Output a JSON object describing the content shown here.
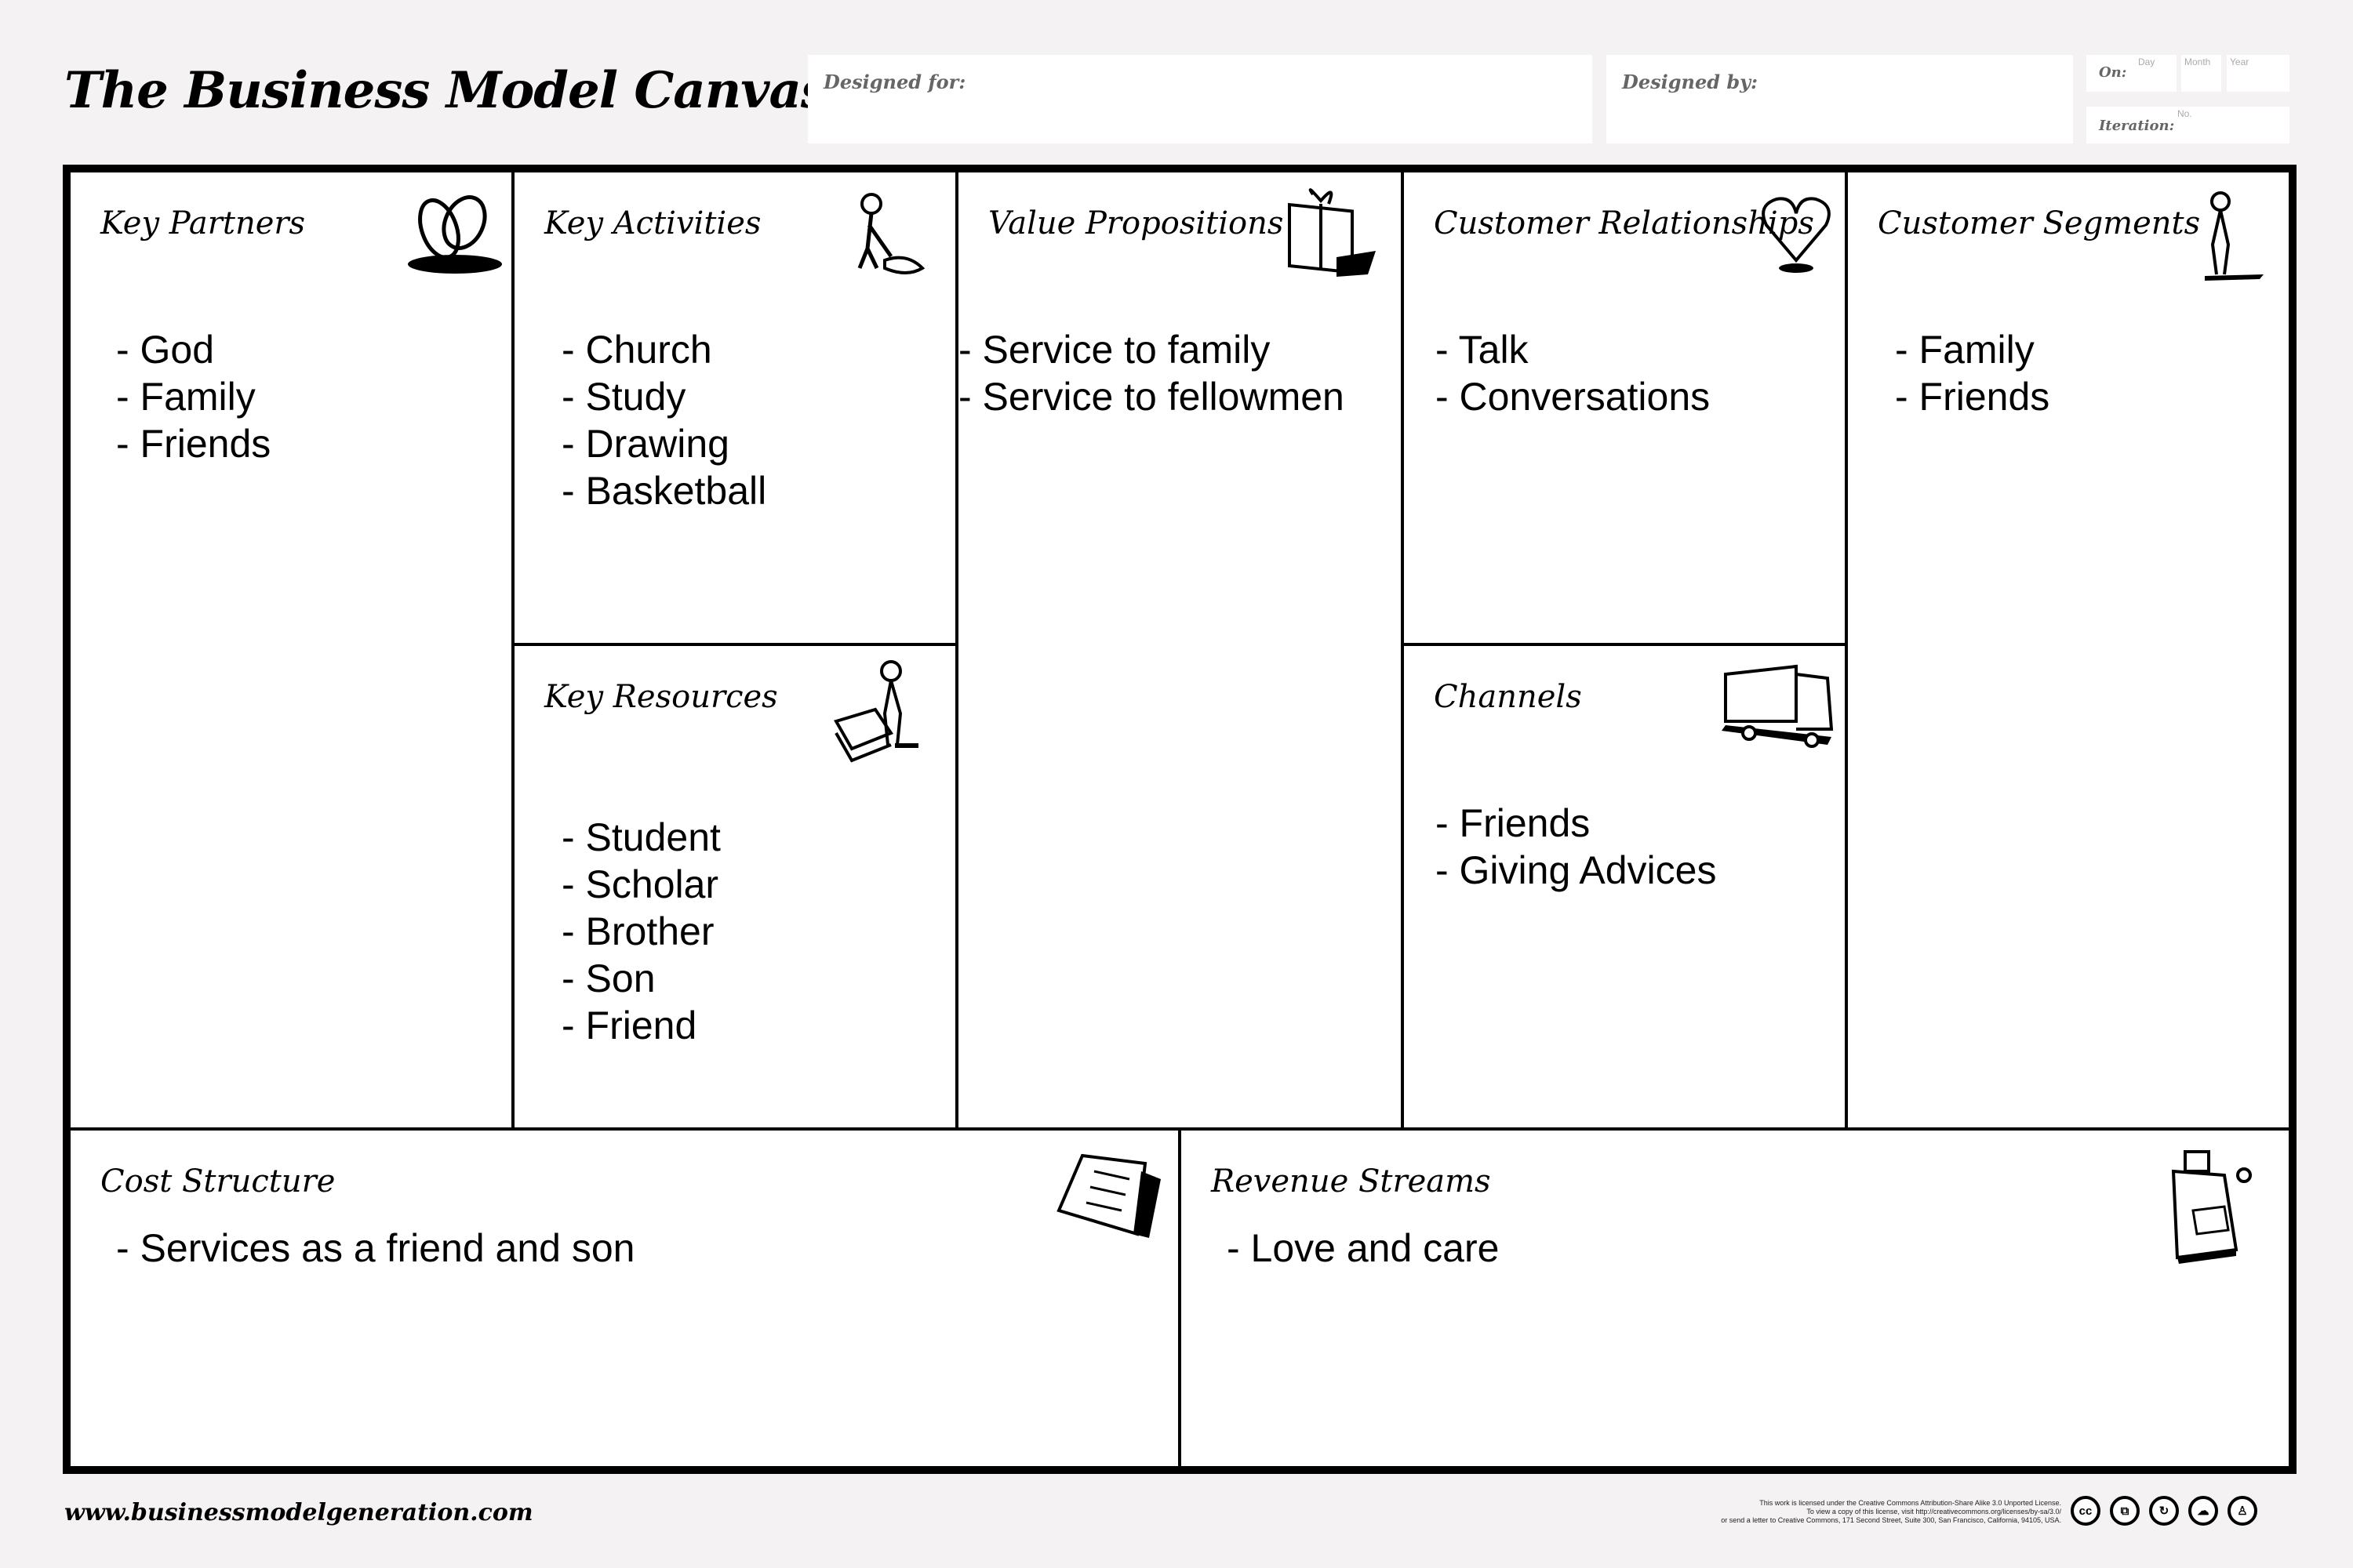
{
  "header": {
    "title": "The Business Model Canvas",
    "designed_for_label": "Designed for:",
    "designed_for_value": "",
    "designed_by_label": "Designed by:",
    "designed_by_value": "",
    "on_label": "On:",
    "day_label": "Day",
    "month_label": "Month",
    "year_label": "Year",
    "iteration_label": "Iteration:",
    "iteration_no_label": "No."
  },
  "blocks": {
    "key_partners": {
      "title": "Key Partners",
      "icon": "rings-icon",
      "items": [
        "- God",
        "- Family",
        "- Friends"
      ]
    },
    "key_activities": {
      "title": "Key Activities",
      "icon": "person-digging-icon",
      "items": [
        "- Church",
        "- Study",
        "- Drawing",
        "- Basketball"
      ]
    },
    "key_resources": {
      "title": "Key Resources",
      "icon": "person-with-cart-icon",
      "items": [
        "- Student",
        "- Scholar",
        "- Brother",
        "- Son",
        "- Friend"
      ]
    },
    "value_propositions": {
      "title": "Value Propositions",
      "icon": "gift-icon",
      "items": [
        "- Service to family",
        "- Service to fellowmen"
      ]
    },
    "customer_relationships": {
      "title": "Customer Relationships",
      "icon": "heart-icon",
      "items": [
        "- Talk",
        "- Conversations"
      ]
    },
    "channels": {
      "title": "Channels",
      "icon": "truck-icon",
      "items": [
        "- Friends",
        "- Giving Advices"
      ]
    },
    "customer_segments": {
      "title": "Customer Segments",
      "icon": "person-standing-icon",
      "items": [
        "- Family",
        "- Friends"
      ]
    },
    "cost_structure": {
      "title": "Cost Structure",
      "icon": "receipt-icon",
      "items": [
        "- Services as a friend and son"
      ]
    },
    "revenue_streams": {
      "title": "Revenue Streams",
      "icon": "cash-register-icon",
      "items": [
        "- Love and care"
      ]
    }
  },
  "footer": {
    "url": "www.businessmodelgeneration.com",
    "license_lines": [
      "This work is licensed under the Creative Commons Attribution-Share Alike 3.0 Unported License.",
      "To view a copy of this license, visit http://creativecommons.org/licenses/by-sa/3.0/",
      "or send a letter to Creative Commons, 171 Second Street, Suite 300, San Francisco, California, 94105, USA."
    ],
    "cc_icons": [
      {
        "name": "cc-icon",
        "glyph": "cc"
      },
      {
        "name": "copy-icon",
        "glyph": "⧉"
      },
      {
        "name": "share-alike-icon",
        "glyph": "↻"
      },
      {
        "name": "noncommercial-icon",
        "glyph": "☁"
      },
      {
        "name": "attribution-icon",
        "glyph": "♙"
      }
    ]
  }
}
